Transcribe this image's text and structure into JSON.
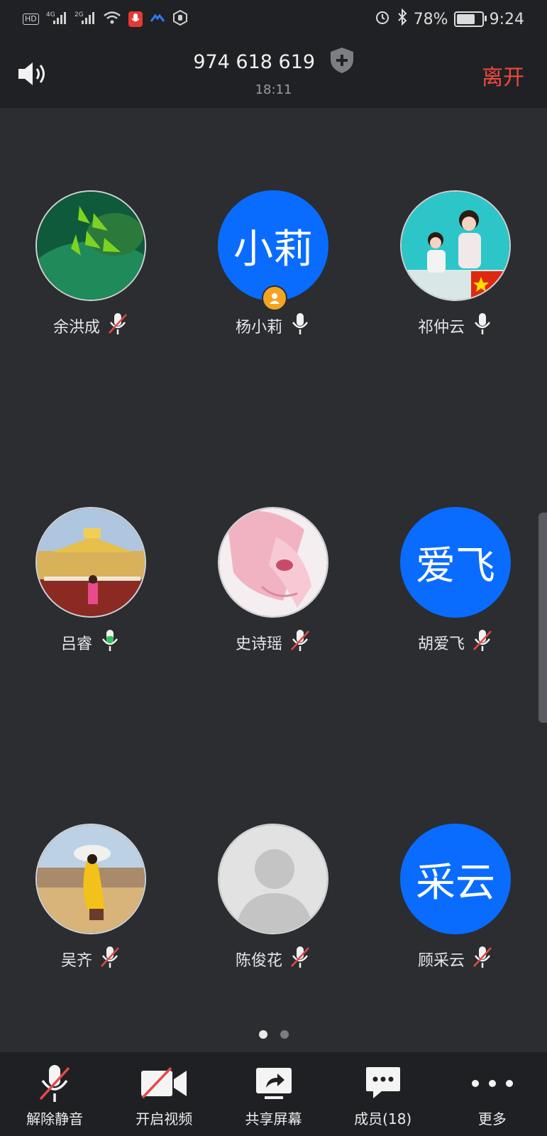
{
  "status_bar": {
    "left_chips": [
      "HD",
      "4G",
      "2G"
    ],
    "battery": "78%",
    "battery_level": 0.78,
    "time": "9:24",
    "icons": [
      "hd-icon",
      "signal-4g-icon",
      "signal-2g-icon",
      "wifi-icon",
      "mic-recording-icon",
      "app-notification-icon",
      "hand-icon",
      "alarm-icon",
      "bluetooth-icon",
      "battery-icon"
    ]
  },
  "header": {
    "meeting_id": "974 618 619",
    "elapsed": "18:11",
    "leave_label": "离开"
  },
  "participants": [
    {
      "name": "余洪成",
      "mic": "muted",
      "avatar_type": "photo",
      "photo": "green-leaves"
    },
    {
      "name": "杨小莉",
      "mic": "on",
      "avatar_type": "text",
      "avatar_text": "小莉",
      "host_badge": true
    },
    {
      "name": "祁仲云",
      "mic": "on",
      "avatar_type": "photo",
      "photo": "mother-child"
    },
    {
      "name": "吕睿",
      "mic": "speaking",
      "avatar_type": "photo",
      "photo": "palace"
    },
    {
      "name": "史诗瑶",
      "mic": "muted",
      "avatar_type": "photo",
      "photo": "anime"
    },
    {
      "name": "胡爱飞",
      "mic": "muted",
      "avatar_type": "text",
      "avatar_text": "爱飞"
    },
    {
      "name": "吴齐",
      "mic": "muted",
      "avatar_type": "photo",
      "photo": "desert"
    },
    {
      "name": "陈俊花",
      "mic": "muted",
      "avatar_type": "placeholder"
    },
    {
      "name": "顾采云",
      "mic": "muted",
      "avatar_type": "text",
      "avatar_text": "采云"
    }
  ],
  "pager": {
    "pages": 2,
    "current": 1
  },
  "toolbar": {
    "unmute": "解除静音",
    "video": "开启视频",
    "share": "共享屏幕",
    "members": "成员(18)",
    "more": "更多"
  },
  "colors": {
    "background": "#2b2d31",
    "bar": "#202124",
    "accent_blue": "#0a6cff",
    "leave_red": "#f0493e",
    "speaking_green": "#2fc55a",
    "host_badge": "#f3a521"
  }
}
